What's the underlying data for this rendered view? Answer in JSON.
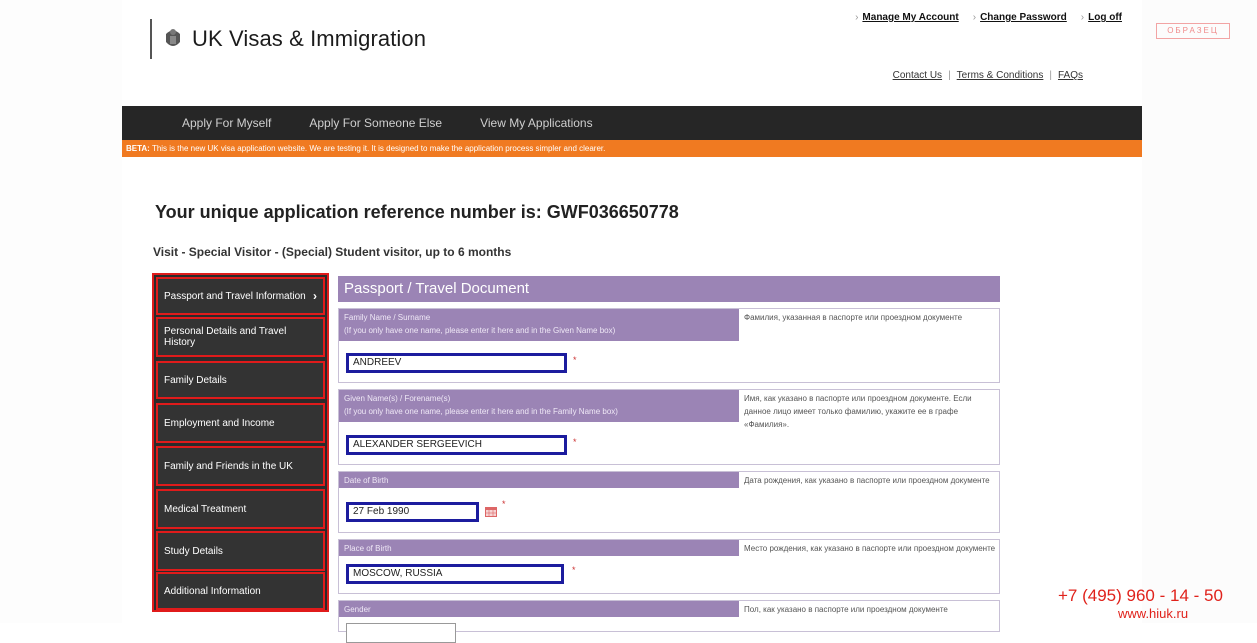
{
  "header": {
    "brand": "UK Visas & Immigration",
    "top_links": [
      "Manage My Account",
      "Change Password",
      "Log off"
    ],
    "sub_links": [
      "Contact Us",
      "Terms & Conditions",
      "FAQs"
    ],
    "stamp": "ОБРАЗЕЦ"
  },
  "nav": {
    "items": [
      "Apply For Myself",
      "Apply For Someone Else",
      "View My Applications"
    ],
    "beta_label": "BETA:",
    "beta_text": "This is the new UK visa application website. We are testing it. It is designed to make the application process simpler and clearer."
  },
  "page": {
    "reference_title": "Your unique application reference number is: GWF036650778",
    "visa_title": "Visit - Special Visitor - (Special) Student visitor, up to 6 months"
  },
  "sidebar": {
    "items": [
      {
        "label": "Passport and Travel Information",
        "active": true
      },
      {
        "label": "Personal Details and Travel History"
      },
      {
        "label": "Family Details"
      },
      {
        "label": "Employment and Income"
      },
      {
        "label": "Family and Friends in the UK"
      },
      {
        "label": "Medical Treatment"
      },
      {
        "label": "Study Details"
      },
      {
        "label": "Additional Information"
      }
    ]
  },
  "form": {
    "title": "Passport / Travel Document",
    "sections": [
      {
        "label": "Family Name / Surname",
        "sublabel": "(If you only have one name, please enter it here and in the Given Name box)",
        "hint": "Фамилия, указанная в паспорте или проездном документе",
        "value": "ANDREEV"
      },
      {
        "label": "Given Name(s) / Forename(s)",
        "sublabel": "(If you only have one name, please enter it here and in the Family Name box)",
        "hint": "Имя, как указано в паспорте или проездном документе. Если данное лицо имеет только фамилию, укажите ее в графе «Фамилия».",
        "value": "ALEXANDER SERGEEVICH"
      },
      {
        "label": "Date of Birth",
        "hint": "Дата рождения, как указано в паспорте или проездном документе",
        "value": "27 Feb 1990"
      },
      {
        "label": "Place of Birth",
        "hint": "Место рождения, как указано в паспорте или проездном документе",
        "value": "MOSCOW, RUSSIA"
      },
      {
        "label": "Gender",
        "hint": "Пол, как указано в паспорте или проездном документе",
        "value": ""
      }
    ],
    "required_mark": "*"
  },
  "contact": {
    "phone": "+7 (495) 960 - 14 - 50",
    "site": "www.hiuk.ru"
  }
}
